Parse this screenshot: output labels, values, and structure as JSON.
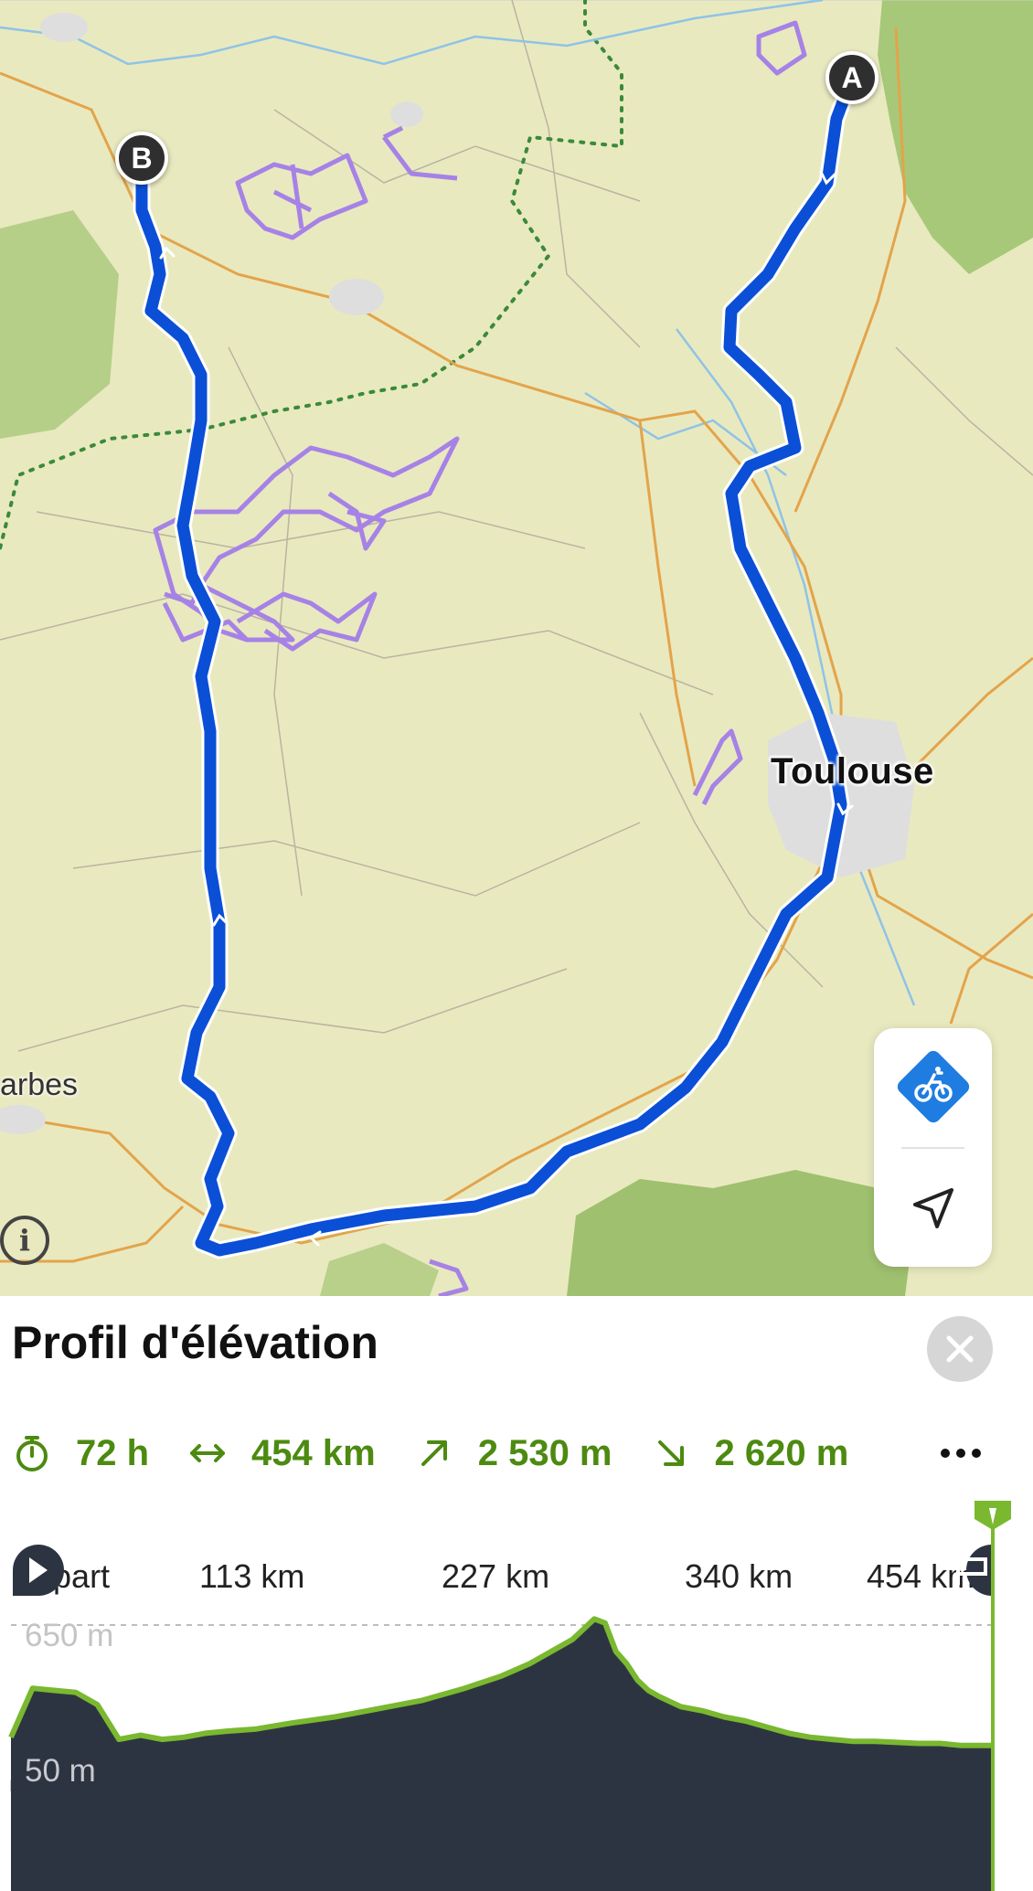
{
  "map": {
    "markers": {
      "start": "A",
      "end": "B"
    },
    "cities": {
      "main": "Toulouse",
      "west": "arbes"
    },
    "info_icon": "info-icon",
    "controls": {
      "bike_icon": "bike-layer-icon",
      "locate_icon": "locate-arrow-icon"
    },
    "colors": {
      "route": "#0a4fd6",
      "trails": "#a682e6",
      "roads": "#e3a44a",
      "forest": "#9cbf6a"
    }
  },
  "panel": {
    "title": "Profil d'élévation",
    "close_icon": "close-icon",
    "stats": {
      "duration": "72 h",
      "distance": "454 km",
      "ascent": "2 530 m",
      "descent": "2 620 m"
    },
    "more_icon": "more-icon",
    "distance_axis": [
      "Départ",
      "113 km",
      "227 km",
      "340 km",
      "454 km"
    ],
    "elevation_labels": {
      "high": "650 m",
      "low": "50 m"
    },
    "accent_color": "#7ab830"
  },
  "chart_data": {
    "type": "area",
    "xlabel": "",
    "ylabel": "",
    "x_ticks": [
      "Départ",
      "113 km",
      "227 km",
      "340 km",
      "454 km"
    ],
    "x": [
      0,
      10,
      20,
      30,
      40,
      50,
      60,
      70,
      80,
      90,
      100,
      113,
      130,
      150,
      170,
      190,
      210,
      227,
      240,
      250,
      260,
      265,
      270,
      275,
      280,
      285,
      290,
      295,
      300,
      310,
      320,
      330,
      340,
      350,
      360,
      370,
      380,
      390,
      400,
      410,
      420,
      430,
      440,
      454
    ],
    "y": [
      100,
      340,
      330,
      320,
      260,
      90,
      110,
      90,
      100,
      120,
      130,
      140,
      170,
      200,
      240,
      280,
      340,
      400,
      460,
      520,
      580,
      630,
      680,
      660,
      520,
      460,
      380,
      330,
      300,
      250,
      230,
      200,
      180,
      150,
      120,
      100,
      90,
      80,
      80,
      75,
      70,
      70,
      60,
      60
    ],
    "ylim": [
      50,
      650
    ],
    "xlim": [
      0,
      454
    ]
  }
}
